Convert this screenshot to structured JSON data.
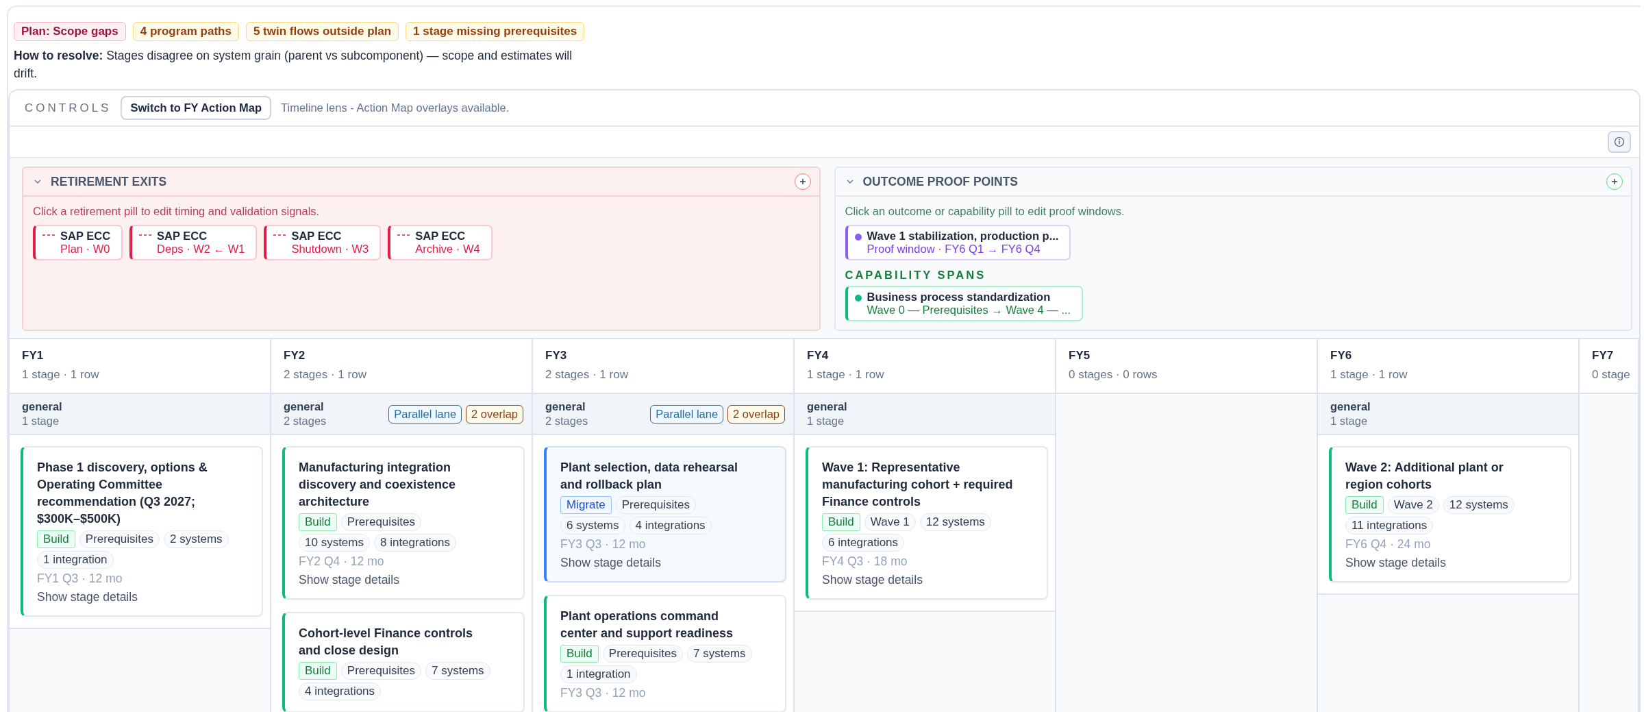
{
  "summary_badges": [
    {
      "text": "Plan: Scope gaps",
      "kind": "danger"
    },
    {
      "text": "4 program paths",
      "kind": "warning"
    },
    {
      "text": "5 twin flows outside plan",
      "kind": "warning"
    },
    {
      "text": "1 stage missing prerequisites",
      "kind": "warning"
    }
  ],
  "resolution": "**How to resolve:** Stages disagree on system grain (parent vs subcomponent) — scope and estimates will drift.",
  "controls": {
    "label": "CONTROLS",
    "button": "Switch to FY Action Map",
    "lens": "Timeline lens - Action Map overlays available."
  },
  "retirement_panel": {
    "title": "RETIREMENT EXITS",
    "expanded": true,
    "hint": "Click a retirement pill to edit timing and validation signals.",
    "pills": [
      {
        "title": "SAP ECC",
        "detail": "Plan · W0"
      },
      {
        "title": "SAP ECC",
        "detail": "Deps · W2 ← W1"
      },
      {
        "title": "SAP ECC",
        "detail": "Shutdown · W3"
      },
      {
        "title": "SAP ECC",
        "detail": "Archive · W4"
      }
    ]
  },
  "outcome_panel": {
    "title": "OUTCOME PROOF POINTS",
    "expanded": true,
    "hint": "Click an outcome or capability pill to edit proof windows.",
    "outcomes": [
      {
        "title": "Wave 1 stabilization, production p...",
        "detail": "Proof window · FY6 Q1 → FY6 Q4"
      }
    ],
    "capability_heading": "CAPABILITY SPANS",
    "capabilities": [
      {
        "title": "Business process standardization",
        "detail": "Wave 0 — Prerequisites → Wave 4 — ..."
      }
    ]
  },
  "timeline": [
    {
      "label": "FY1",
      "summary": "1 stage · 1 row",
      "lanes": [
        {
          "name": "general",
          "count": "1 stage",
          "cards": [
            {
              "title": "Phase 1 discovery, options & Operating Committee recommendation (Q3 2027; $300K–$500K)",
              "kind": "build",
              "type": "Build",
              "chips": [
                "Prerequisites",
                "2 systems",
                "1 integration"
              ],
              "timing": "FY1 Q3 · 12 mo",
              "link": "Show stage details"
            }
          ]
        }
      ]
    },
    {
      "label": "FY2",
      "summary": "2 stages · 1 row",
      "lanes": [
        {
          "name": "general",
          "count": "2 stages",
          "badges": [
            {
              "text": "Parallel lane",
              "kind": "info"
            },
            {
              "text": "2 overlap",
              "kind": "warning"
            }
          ],
          "cards": [
            {
              "title": "Manufacturing integration discovery and coexistence architecture",
              "kind": "build",
              "type": "Build",
              "chips": [
                "Prerequisites",
                "10 systems",
                "8 integrations"
              ],
              "timing": "FY2 Q4 · 12 mo",
              "link": "Show stage details"
            },
            {
              "title": "Cohort-level Finance controls and close design",
              "kind": "build",
              "type": "Build",
              "chips": [
                "Prerequisites",
                "7 systems",
                "4 integrations"
              ]
            }
          ]
        }
      ]
    },
    {
      "label": "FY3",
      "summary": "2 stages · 1 row",
      "lanes": [
        {
          "name": "general",
          "count": "2 stages",
          "badges": [
            {
              "text": "Parallel lane",
              "kind": "info"
            },
            {
              "text": "2 overlap",
              "kind": "warning"
            }
          ],
          "cards": [
            {
              "title": "Plant selection, data rehearsal and rollback plan",
              "kind": "migrate",
              "type": "Migrate",
              "chips": [
                "Prerequisites",
                "6 systems",
                "4 integrations"
              ],
              "timing": "FY3 Q3 · 12 mo",
              "link": "Show stage details"
            },
            {
              "title": "Plant operations command center and support readiness",
              "kind": "build",
              "type": "Build",
              "chips": [
                "Prerequisites",
                "7 systems",
                "1 integration"
              ],
              "timing": "FY3 Q3 · 12 mo"
            }
          ]
        }
      ]
    },
    {
      "label": "FY4",
      "summary": "1 stage · 1 row",
      "lanes": [
        {
          "name": "general",
          "count": "1 stage",
          "cards": [
            {
              "title": "Wave 1: Representative manufacturing cohort + required Finance controls",
              "kind": "build",
              "type": "Build",
              "chips": [
                "Wave 1",
                "12 systems",
                "6 integrations"
              ],
              "timing": "FY4 Q3 · 18 mo",
              "link": "Show stage details"
            }
          ]
        }
      ]
    },
    {
      "label": "FY5",
      "summary": "0 stages · 0 rows"
    },
    {
      "label": "FY6",
      "summary": "1 stage · 1 row",
      "lanes": [
        {
          "name": "general",
          "count": "1 stage",
          "cards": [
            {
              "title": "Wave 2: Additional plant or region cohorts",
              "kind": "build",
              "type": "Build",
              "chips": [
                "Wave 2",
                "12 systems",
                "11 integrations"
              ],
              "timing": "FY6 Q4 · 24 mo",
              "link": "Show stage details"
            }
          ]
        }
      ]
    },
    {
      "label": "FY7",
      "summary": "0 stage"
    }
  ]
}
